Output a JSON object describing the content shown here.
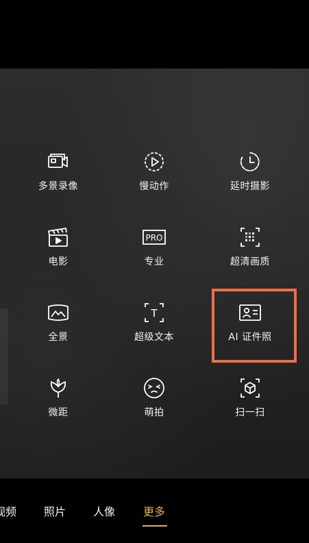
{
  "modes": [
    {
      "id": "multi-view",
      "icon": "multi-scene-video-icon",
      "label": "多景录像"
    },
    {
      "id": "slow-mo",
      "icon": "slow-motion-icon",
      "label": "慢动作"
    },
    {
      "id": "time-lapse",
      "icon": "time-lapse-icon",
      "label": "延时摄影"
    },
    {
      "id": "movie",
      "icon": "clapperboard-icon",
      "label": "电影"
    },
    {
      "id": "pro",
      "icon": "pro-icon",
      "icon_text": "PRO",
      "label": "专业"
    },
    {
      "id": "super-resolution",
      "icon": "super-resolution-icon",
      "label": "超清画质"
    },
    {
      "id": "panorama",
      "icon": "panorama-icon",
      "label": "全景"
    },
    {
      "id": "super-text",
      "icon": "text-scan-icon",
      "icon_text": "T",
      "label": "超级文本"
    },
    {
      "id": "id-photo",
      "icon": "id-card-icon",
      "label": "AI 证件照"
    },
    {
      "id": "macro",
      "icon": "macro-flower-icon",
      "label": "微距"
    },
    {
      "id": "cute",
      "icon": "cute-face-icon",
      "label": "萌拍"
    },
    {
      "id": "scan",
      "icon": "scan-cube-icon",
      "label": "扫一扫"
    }
  ],
  "highlight": {
    "target": "id-photo",
    "color": "#ef6f47"
  },
  "tabs": [
    {
      "label": "视频"
    },
    {
      "label": "照片"
    },
    {
      "label": "人像"
    },
    {
      "label": "更多",
      "active": true
    }
  ],
  "colors": {
    "accent": "#e2b15a",
    "highlight": "#ef6f47"
  }
}
